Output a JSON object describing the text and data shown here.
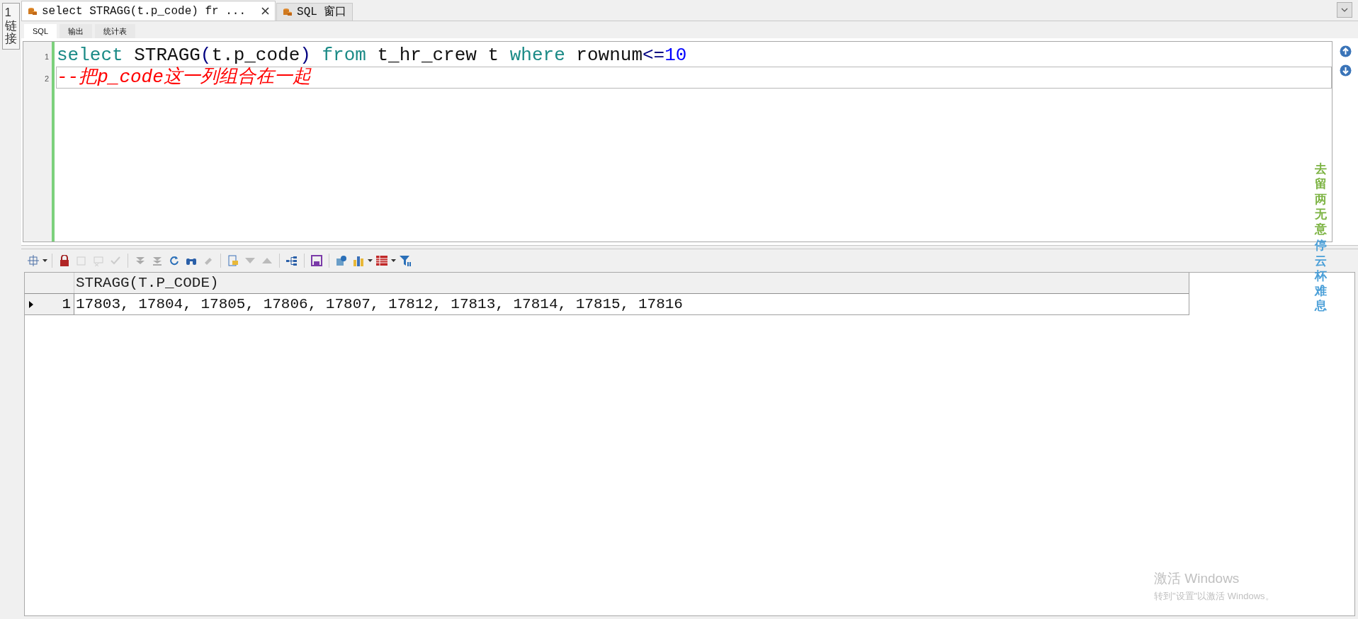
{
  "side_tab": {
    "label": "1链接"
  },
  "tabs": [
    {
      "label": "select STRAGG(t.p_code) fr ...",
      "selected": true,
      "closable": true
    },
    {
      "label": "SQL 窗口",
      "selected": false,
      "closable": false
    }
  ],
  "sub_tabs": [
    {
      "label": "SQL",
      "selected": true
    },
    {
      "label": "输出",
      "selected": false
    },
    {
      "label": "统计表",
      "selected": false
    }
  ],
  "editor": {
    "lines": [
      {
        "number": "1",
        "current": false,
        "tokens": [
          {
            "kind": "keyword",
            "text": "select"
          },
          {
            "kind": "plain",
            "text": " STRAGG"
          },
          {
            "kind": "paren",
            "text": "("
          },
          {
            "kind": "plain",
            "text": "t.p_code"
          },
          {
            "kind": "paren",
            "text": ")"
          },
          {
            "kind": "keyword",
            "text": " from"
          },
          {
            "kind": "plain",
            "text": " t_hr_crew t "
          },
          {
            "kind": "keyword",
            "text": "where"
          },
          {
            "kind": "plain",
            "text": " rownum"
          },
          {
            "kind": "operator",
            "text": "<="
          },
          {
            "kind": "number",
            "text": "10"
          }
        ]
      },
      {
        "number": "2",
        "current": true,
        "tokens": [
          {
            "kind": "comment",
            "text": "--把p_code这一列组合在一起"
          }
        ]
      }
    ]
  },
  "results": {
    "columns": [
      "STRAGG(T.P_CODE)"
    ],
    "rows": [
      {
        "number": "1",
        "selected": true,
        "cells": [
          "17803, 17804, 17805, 17806, 17807, 17812, 17813, 17814, 17815, 17816"
        ]
      }
    ]
  },
  "desktop_poem": [
    {
      "text": "去留两无意",
      "color": "#7cb342"
    },
    {
      "text": "停云杯难息",
      "color": "#4a9fd8"
    }
  ],
  "activation_notice": {
    "title": "激活 Windows",
    "message": "转到\"设置\"以激活 Windows。"
  }
}
